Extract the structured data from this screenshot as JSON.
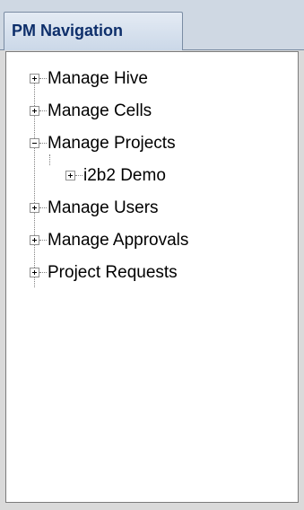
{
  "window": {
    "tab_title": "PM Navigation"
  },
  "tree": {
    "items": [
      {
        "label": "Manage Hive",
        "expanded": false
      },
      {
        "label": "Manage Cells",
        "expanded": false
      },
      {
        "label": "Manage Projects",
        "expanded": true,
        "children": [
          {
            "label": "i2b2 Demo",
            "expanded": false
          }
        ]
      },
      {
        "label": "Manage Users",
        "expanded": false
      },
      {
        "label": "Manage Approvals",
        "expanded": false
      },
      {
        "label": "Project Requests",
        "expanded": false
      }
    ]
  },
  "colors": {
    "tab_text": "#0e2f6b",
    "tab_background": "#cbd8e8",
    "tree_background": "#ffffff",
    "panel_background": "#dadada"
  },
  "icons": {
    "collapsed": "plus-box-icon",
    "expanded": "minus-box-icon"
  }
}
